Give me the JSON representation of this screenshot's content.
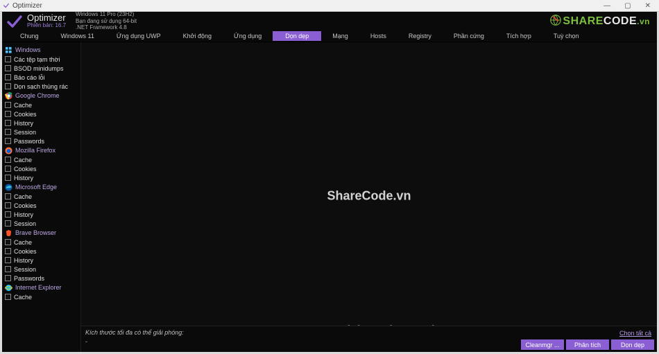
{
  "titlebar": {
    "title": "Optimizer",
    "min": "—",
    "max": "▢",
    "close": "✕"
  },
  "header": {
    "app_name": "Optimizer",
    "version_label": "Phiên bản: 16.7",
    "os_line": "Windows 11 Pro (23H2)",
    "arch_line": "Bạn đang sử dụng 64-bit",
    "net_line": ".NET Framework 4.8"
  },
  "brand": {
    "part1": "SHARE",
    "part2": "CODE",
    "part3": ".vn"
  },
  "tabs": [
    {
      "label": "Chung",
      "active": false
    },
    {
      "label": "Windows 11",
      "active": false
    },
    {
      "label": "Ứng dụng UWP",
      "active": false
    },
    {
      "label": "Khởi động",
      "active": false
    },
    {
      "label": "Ứng dụng",
      "active": false
    },
    {
      "label": "Dọn dẹp",
      "active": true
    },
    {
      "label": "Mạng",
      "active": false
    },
    {
      "label": "Hosts",
      "active": false
    },
    {
      "label": "Registry",
      "active": false
    },
    {
      "label": "Phần cứng",
      "active": false
    },
    {
      "label": "Tích hợp",
      "active": false
    },
    {
      "label": "Tuỳ chọn",
      "active": false
    }
  ],
  "sidebar": [
    {
      "type": "hdr",
      "icon": "windows",
      "label": "Windows"
    },
    {
      "type": "item",
      "label": "Các tệp tạm thời"
    },
    {
      "type": "item",
      "label": "BSOD minidumps"
    },
    {
      "type": "item",
      "label": "Báo cáo lỗi"
    },
    {
      "type": "item",
      "label": "Dọn sạch thùng rác"
    },
    {
      "type": "hdr",
      "icon": "chrome",
      "label": "Google Chrome"
    },
    {
      "type": "item",
      "label": "Cache"
    },
    {
      "type": "item",
      "label": "Cookies"
    },
    {
      "type": "item",
      "label": "History"
    },
    {
      "type": "item",
      "label": "Session"
    },
    {
      "type": "item",
      "label": "Passwords"
    },
    {
      "type": "hdr",
      "icon": "firefox",
      "label": "Mozilla Firefox"
    },
    {
      "type": "item",
      "label": "Cache"
    },
    {
      "type": "item",
      "label": "Cookies"
    },
    {
      "type": "item",
      "label": "History"
    },
    {
      "type": "hdr",
      "icon": "edge",
      "label": "Microsoft Edge"
    },
    {
      "type": "item",
      "label": "Cache"
    },
    {
      "type": "item",
      "label": "Cookies"
    },
    {
      "type": "item",
      "label": "History"
    },
    {
      "type": "item",
      "label": "Session"
    },
    {
      "type": "hdr",
      "icon": "brave",
      "label": "Brave Browser"
    },
    {
      "type": "item",
      "label": "Cache"
    },
    {
      "type": "item",
      "label": "Cookies"
    },
    {
      "type": "item",
      "label": "History"
    },
    {
      "type": "item",
      "label": "Session"
    },
    {
      "type": "item",
      "label": "Passwords"
    },
    {
      "type": "hdr",
      "icon": "ie",
      "label": "Internet Explorer"
    },
    {
      "type": "item",
      "label": "Cache"
    }
  ],
  "watermarks": {
    "center": "ShareCode.vn",
    "bottom": "Copyright © ShareCode.vn"
  },
  "footer": {
    "size_text": "Kích thước tối đa có thể giải phóng:",
    "size_value": "-",
    "select_all": "Chọn tất cả",
    "buttons": [
      {
        "label": "Cleanmgr ..."
      },
      {
        "label": "Phân tích"
      },
      {
        "label": "Dọn dẹp"
      }
    ]
  }
}
